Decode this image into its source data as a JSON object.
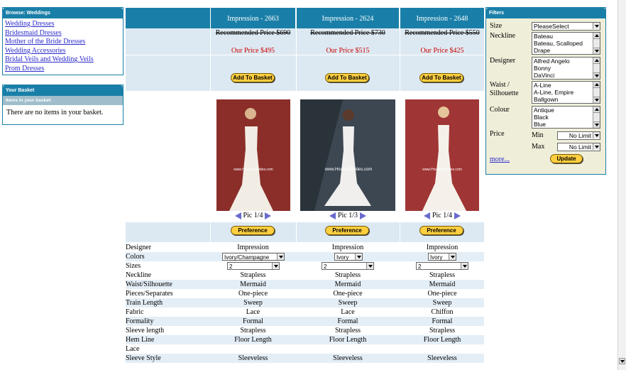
{
  "browse": {
    "title": "Browse: Weddings",
    "links": [
      "Wedding Dresses",
      "Bridesmaid Dresses",
      "Mother of the Bride Dresses",
      "Wedding Accessories",
      "Bridal Veils and Wedding Veils",
      "Prom Dresses"
    ]
  },
  "basket": {
    "title": "Your Basket",
    "subheader": "Items in your basket:",
    "empty_text": "There are no items in your basket."
  },
  "products": [
    {
      "name": "Impression - 2663",
      "recommended": "Recommended Price $690",
      "our_price": "Our Price $495",
      "pic": "Pic 1/4",
      "photo_bg": "#8b2e2a",
      "watermark": "www.HouseofBrides.com",
      "color_value": "Ivory/Champagne",
      "size_value": "2"
    },
    {
      "name": "Impression - 2624",
      "recommended": "Recommended Price $730",
      "our_price": "Our Price $515",
      "pic": "Pic 1/3",
      "photo_bg": "#3d4752",
      "watermark": "www.HouseofBrides.com",
      "color_value": "Ivory",
      "size_value": "2"
    },
    {
      "name": "Impression - 2648",
      "recommended": "Recommended Price $550",
      "our_price": "Our Price $425",
      "pic": "Pic 1/4",
      "photo_bg": "#a03535",
      "watermark": "www.HouseofBrides.com",
      "color_value": "Ivory",
      "size_value": "2"
    }
  ],
  "buttons": {
    "add_to_basket": "Add To Basket",
    "preference": "Preference",
    "update": "Update"
  },
  "attributes": {
    "designer": {
      "label": "Designer",
      "values": [
        "Impression",
        "Impression",
        "Impression"
      ]
    },
    "colors": {
      "label": "Colors"
    },
    "sizes": {
      "label": "Sizes"
    },
    "rows": [
      {
        "label": "Neckline",
        "values": [
          "Strapless",
          "Strapless",
          "Strapless"
        ]
      },
      {
        "label": "Waist/Silhouette",
        "values": [
          "Mermaid",
          "Mermaid",
          "Mermaid"
        ]
      },
      {
        "label": "Pieces/Separates",
        "values": [
          "One-piece",
          "One-piece",
          "One-piece"
        ]
      },
      {
        "label": "Train Length",
        "values": [
          "Sweep",
          "Sweep",
          "Sweep"
        ]
      },
      {
        "label": "Fabric",
        "values": [
          "Lace",
          "Lace",
          "Chiffon"
        ]
      },
      {
        "label": "Formality",
        "values": [
          "Formal",
          "Formal",
          "Formal"
        ]
      },
      {
        "label": "Sleeve length",
        "values": [
          "Strapless",
          "Strapless",
          "Strapless"
        ]
      },
      {
        "label": "Hem Line",
        "values": [
          "Floor Length",
          "Floor Length",
          "Floor Length"
        ]
      },
      {
        "label": "Lace",
        "values": [
          "",
          "",
          ""
        ]
      },
      {
        "label": "Sleeve Style",
        "values": [
          "Sleeveless",
          "Sleeveless",
          "Sleeveless"
        ]
      }
    ]
  },
  "filters": {
    "title": "Filters",
    "size": {
      "label": "Size",
      "value": "PleaseSelect"
    },
    "neckline": {
      "label": "Neckline",
      "options": [
        "Bateau",
        "Bateau, Scalloped",
        "Drape"
      ]
    },
    "designer": {
      "label": "Designer",
      "options": [
        "Alfred Angelo",
        "Bonny",
        "DaVinci"
      ]
    },
    "waist": {
      "label": "Waist / Silhouette",
      "label1": "Waist /",
      "label2": "Silhouette",
      "options": [
        "A-Line",
        "A-Line, Empire",
        "Ballgown"
      ]
    },
    "colour": {
      "label": "Colour",
      "options": [
        "Antique",
        "Black",
        "Blue"
      ]
    },
    "price": {
      "label": "Price",
      "min_label": "Min",
      "max_label": "Max",
      "min_value": "No Limit",
      "max_value": "No Limit"
    },
    "more": "more..."
  },
  "colors": {
    "header_blue": "#1a7fa8",
    "price_red": "#cc0000",
    "button_yellow": "#ffcf40",
    "row_shade": "#e4eef6",
    "filter_bg": "#efeed9",
    "link_blue": "#2a2acc"
  }
}
